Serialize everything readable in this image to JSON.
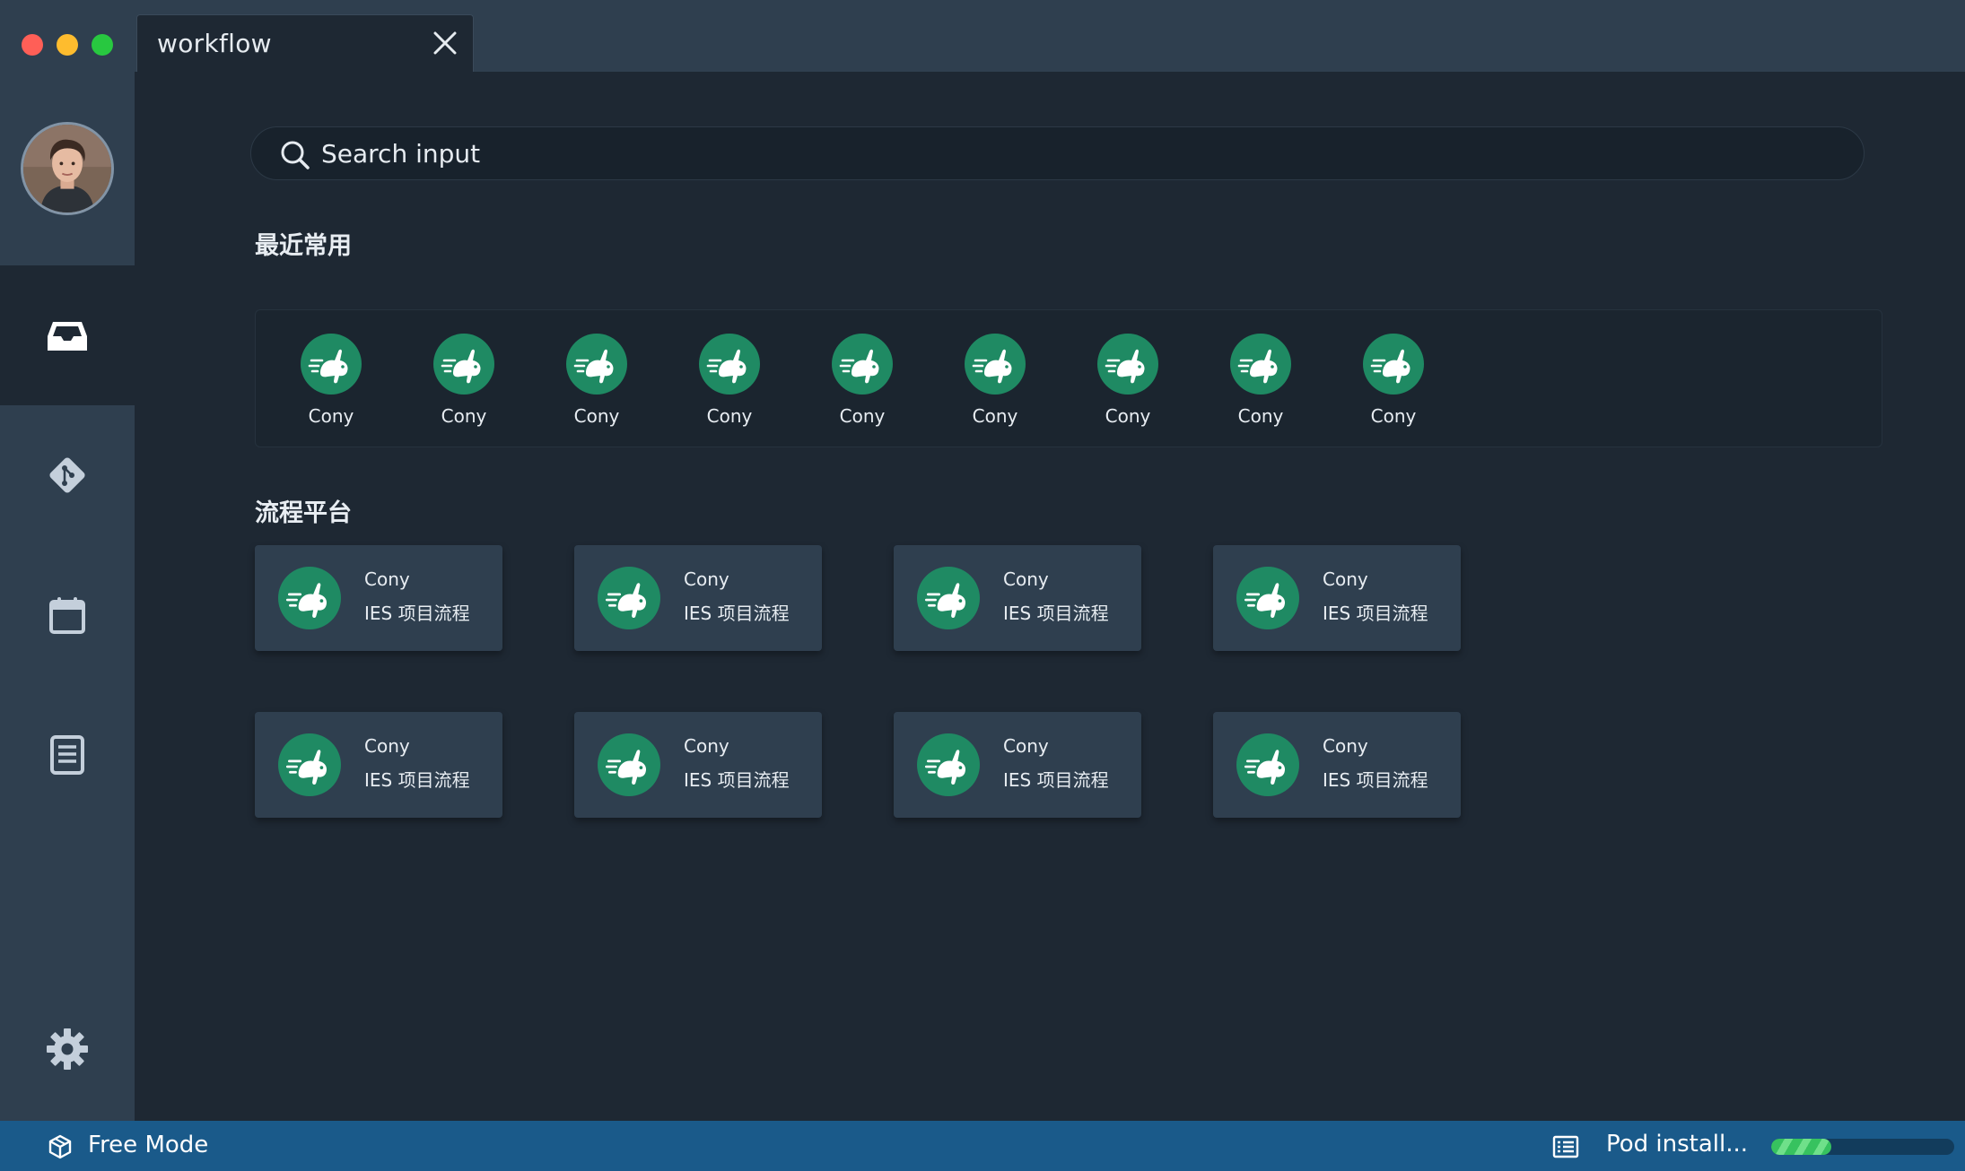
{
  "window": {
    "tab_title": "workflow"
  },
  "sidebar": {
    "items": [
      {
        "icon": "inbox-icon",
        "active": true
      },
      {
        "icon": "git-icon",
        "active": false
      },
      {
        "icon": "calendar-icon",
        "active": false
      },
      {
        "icon": "document-icon",
        "active": false
      }
    ],
    "settings_icon": "gear-icon"
  },
  "search": {
    "placeholder": "Search input"
  },
  "recent": {
    "title": "最近常用",
    "items": [
      {
        "name": "Cony"
      },
      {
        "name": "Cony"
      },
      {
        "name": "Cony"
      },
      {
        "name": "Cony"
      },
      {
        "name": "Cony"
      },
      {
        "name": "Cony"
      },
      {
        "name": "Cony"
      },
      {
        "name": "Cony"
      },
      {
        "name": "Cony"
      }
    ]
  },
  "platform": {
    "title": "流程平台",
    "cards": [
      {
        "name": "Cony",
        "subtitle": "IES 项目流程"
      },
      {
        "name": "Cony",
        "subtitle": "IES 项目流程"
      },
      {
        "name": "Cony",
        "subtitle": "IES 项目流程"
      },
      {
        "name": "Cony",
        "subtitle": "IES 项目流程"
      },
      {
        "name": "Cony",
        "subtitle": "IES 项目流程"
      },
      {
        "name": "Cony",
        "subtitle": "IES 项目流程"
      },
      {
        "name": "Cony",
        "subtitle": "IES 项目流程"
      },
      {
        "name": "Cony",
        "subtitle": "IES 项目流程"
      }
    ]
  },
  "statusbar": {
    "mode": "Free Mode",
    "task": "Pod install...",
    "progress": 0.33
  },
  "colors": {
    "brand_green": "#1f8a63",
    "statusbar_blue": "#1a5a8a",
    "progress_green": "#37c25f"
  }
}
